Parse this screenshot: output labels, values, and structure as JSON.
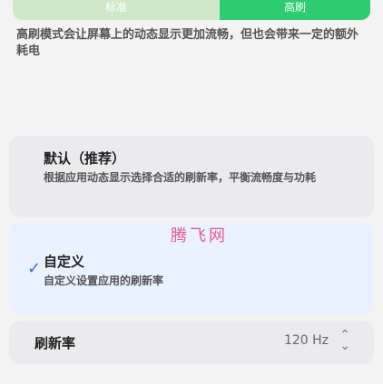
{
  "segment": {
    "left_label": "标准",
    "right_label": "高刷"
  },
  "description": "高刷模式会让屏幕上的动态显示更加流畅，但也会带来一定的额外耗电",
  "options": [
    {
      "title": "默认（推荐）",
      "desc": "根据应用动态显示选择合适的刷新率，平衡流畅度与功耗",
      "selected": false
    },
    {
      "title": "自定义",
      "desc": "自定义设置应用的刷新率",
      "selected": true
    }
  ],
  "watermark": "腾飞网",
  "refresh_row": {
    "label": "刷新率",
    "value": "120 Hz"
  },
  "colors": {
    "accent": "#2ecc71",
    "check": "#2f6fe0",
    "watermark": "#e85a8c"
  }
}
